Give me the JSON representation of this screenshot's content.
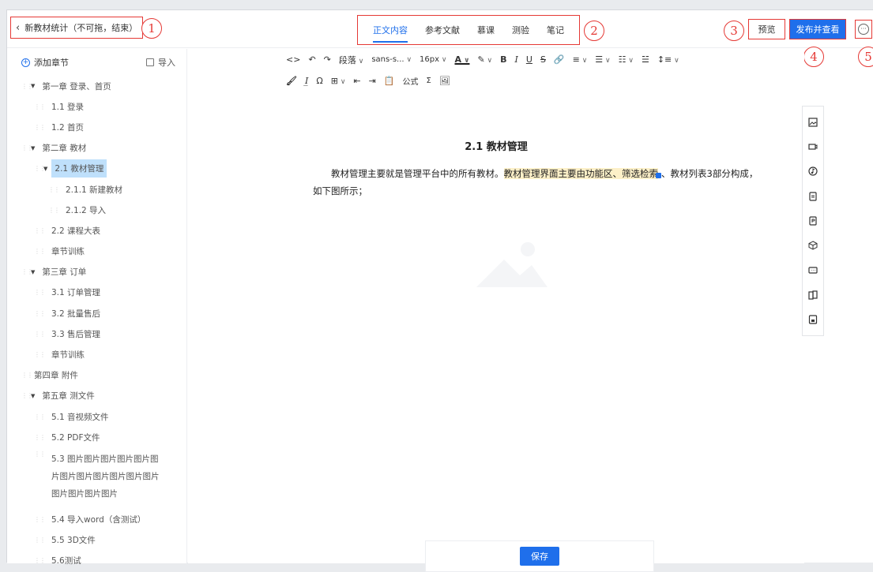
{
  "header": {
    "back_label": "新教材统计（不可拖，结束）",
    "tabs": [
      {
        "label": "正文内容",
        "active": true
      },
      {
        "label": "参考文献",
        "active": false
      },
      {
        "label": "慕课",
        "active": false
      },
      {
        "label": "测验",
        "active": false
      },
      {
        "label": "笔记",
        "active": false
      }
    ],
    "preview_label": "预览",
    "publish_label": "发布并查看",
    "markers": [
      "1",
      "2",
      "3",
      "4",
      "5"
    ]
  },
  "sidebar": {
    "add_chapter_label": "添加章节",
    "import_label": "导入",
    "items": [
      {
        "label": "第一章 登录、首页",
        "level": 0,
        "expanded": true
      },
      {
        "label": "1.1 登录",
        "level": 1
      },
      {
        "label": "1.2 首页",
        "level": 1
      },
      {
        "label": "第二章 教材",
        "level": 0,
        "expanded": true
      },
      {
        "label": "2.1 教材管理",
        "level": 1,
        "expanded": true,
        "selected": true
      },
      {
        "label": "2.1.1 新建教材",
        "level": 2
      },
      {
        "label": "2.1.2 导入",
        "level": 2
      },
      {
        "label": "2.2 课程大表",
        "level": 1
      },
      {
        "label": "章节训练",
        "level": 1
      },
      {
        "label": "第三章 订单",
        "level": 0,
        "expanded": true
      },
      {
        "label": "3.1 订单管理",
        "level": 1
      },
      {
        "label": "3.2 批量售后",
        "level": 1
      },
      {
        "label": "3.3 售后管理",
        "level": 1
      },
      {
        "label": "章节训练",
        "level": 1
      },
      {
        "label": "第四章 附件",
        "level": 0
      },
      {
        "label": "第五章 测文件",
        "level": 0,
        "expanded": true
      },
      {
        "label": "5.1 音视频文件",
        "level": 1
      },
      {
        "label": "5.2 PDF文件",
        "level": 1
      },
      {
        "label": "5.3 图片图片图片图片图片图片图片图片图片图片图片图片图片图片图片图片",
        "level": 1,
        "multiline": true
      },
      {
        "label": "5.4 导入word（含测试）",
        "level": 1
      },
      {
        "label": "5.5 3D文件",
        "level": 1
      },
      {
        "label": "5.6测试",
        "level": 1
      }
    ]
  },
  "toolbar": {
    "row1": {
      "code": "<>",
      "undo": "↶",
      "redo": "↷",
      "paragraph": "段落",
      "font_family": "sans-s...",
      "font_size": "16px",
      "font_color": "A",
      "highlight": "✎",
      "bold": "B",
      "italic": "I",
      "underline": "U",
      "strike": "S",
      "link": "🔗",
      "align": "≡",
      "bullet_list": "☰",
      "numbered_list": "☷",
      "indent_list": "☱",
      "line_height": "↕≡"
    },
    "row2": {
      "format_painter": "🖌",
      "clear_format": "I̲",
      "special_char": "Ω",
      "table": "⊞",
      "outdent": "⇤",
      "indent": "⇥",
      "paste": "📋",
      "formula": "公式",
      "sigma": "Σ",
      "image": "🖼"
    }
  },
  "document": {
    "title": "2.1 教材管理",
    "p1_a": "教材管理主要就是管理平台中的所有教材。",
    "p1_hl": "教材管理界面主要由功能区、筛选检索",
    "p1_b": "、教材列表3部分构成，",
    "p2": "如下图所示；"
  },
  "save_label": "保存"
}
